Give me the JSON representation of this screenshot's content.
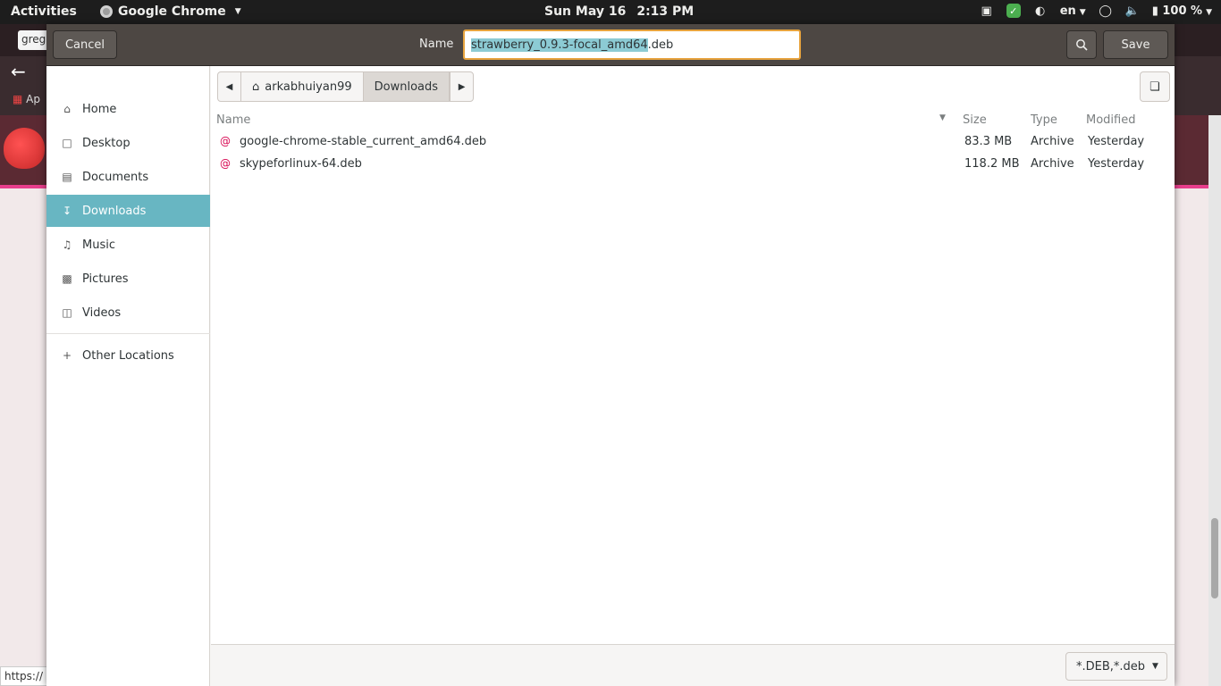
{
  "topbar": {
    "activities": "Activities",
    "app_name": "Google Chrome",
    "date": "Sun May 16",
    "time": "2:13 PM",
    "language": "en",
    "battery": "100 %"
  },
  "background": {
    "tab_label": "greg",
    "bookmark_apps": "Ap",
    "status_url": "https://"
  },
  "dialog": {
    "cancel_label": "Cancel",
    "name_label": "Name",
    "filename_selected": "strawberry_0.9.3-focal_amd64",
    "filename_ext": ".deb",
    "save_label": "Save",
    "sidebar": [
      {
        "label": "Home",
        "icon": "home-icon"
      },
      {
        "label": "Desktop",
        "icon": "desktop-icon"
      },
      {
        "label": "Documents",
        "icon": "documents-icon"
      },
      {
        "label": "Downloads",
        "icon": "downloads-icon",
        "active": true
      },
      {
        "label": "Music",
        "icon": "music-icon"
      },
      {
        "label": "Pictures",
        "icon": "pictures-icon"
      },
      {
        "label": "Videos",
        "icon": "videos-icon"
      },
      {
        "label": "Other Locations",
        "icon": "plus-icon"
      }
    ],
    "path": {
      "home_segment": "arkabhuiyan99",
      "current_segment": "Downloads"
    },
    "columns": {
      "name": "Name",
      "size": "Size",
      "type": "Type",
      "modified": "Modified"
    },
    "files": [
      {
        "name": "google-chrome-stable_current_amd64.deb",
        "size": "83.3 MB",
        "type": "Archive",
        "modified": "Yesterday"
      },
      {
        "name": "skypeforlinux-64.deb",
        "size": "118.2 MB",
        "type": "Archive",
        "modified": "Yesterday"
      }
    ],
    "filter": "*.DEB,*.deb"
  }
}
